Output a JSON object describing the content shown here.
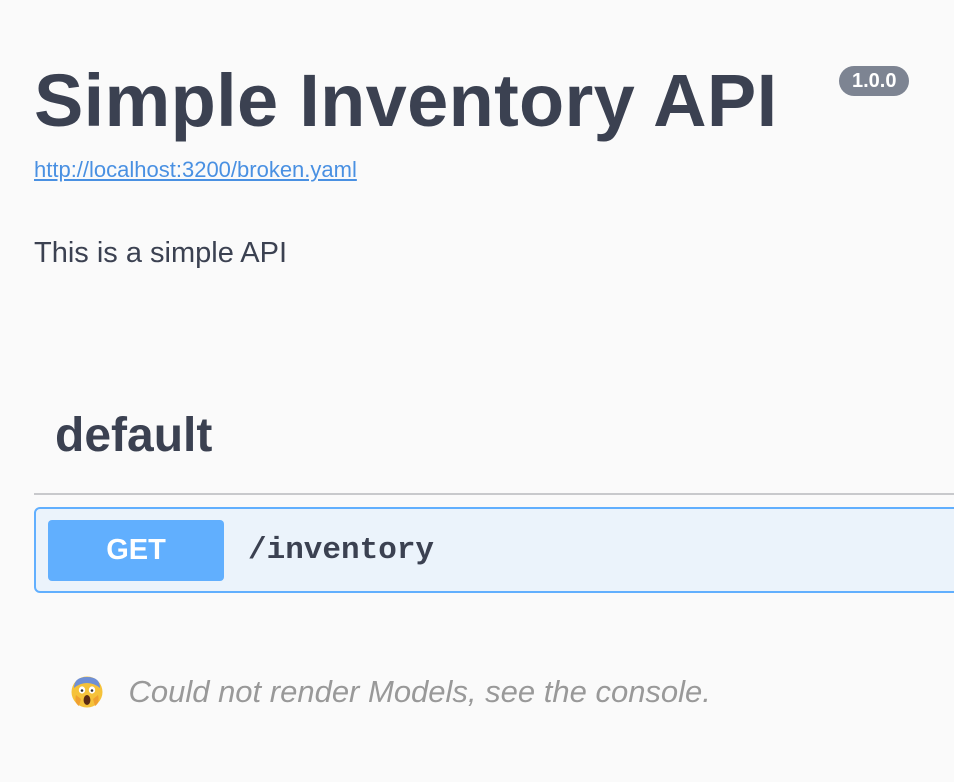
{
  "info": {
    "title": "Simple Inventory API",
    "version": "1.0.0",
    "spec_url": "http://localhost:3200/broken.yaml",
    "description": "This is a simple API"
  },
  "tags": [
    {
      "name": "default",
      "operations": [
        {
          "method": "GET",
          "path": "/inventory"
        }
      ]
    }
  ],
  "models": {
    "icon": "face-screaming-icon",
    "error_message": "Could not render Models, see the console."
  },
  "colors": {
    "get_accent": "#61affe",
    "get_background": "#ebf3fb",
    "link": "#4990e2",
    "version_badge": "#7d8492",
    "text": "#3b4151"
  }
}
